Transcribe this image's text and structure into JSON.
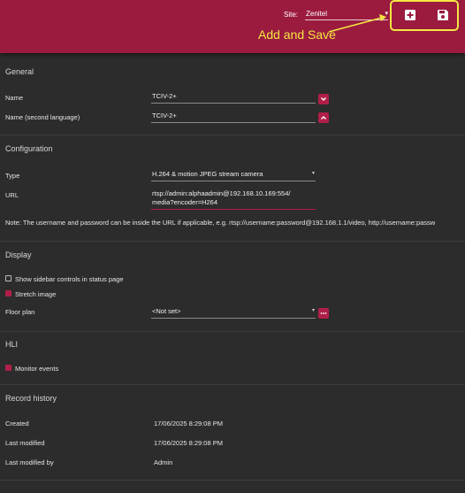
{
  "header": {
    "site_label": "Site:",
    "site_value": "Zenitel",
    "add_icon": "plus-box-icon",
    "save_icon": "floppy-disk-icon"
  },
  "annotation": {
    "text": "Add and Save",
    "color": "#f4e642"
  },
  "colors": {
    "brand": "#9b1b3f",
    "accent": "#b01f48",
    "background": "#2c2c2c"
  },
  "general": {
    "title": "General",
    "name_label": "Name",
    "name_value": "TCIV-2+",
    "name2_label": "Name (second language)",
    "name2_value": "TCIV-2+"
  },
  "configuration": {
    "title": "Configuration",
    "type_label": "Type",
    "type_value": "H.264 & motion JPEG stream camera",
    "url_label": "URL",
    "url_line1": "rtsp://admin:alphaadmin@192.168.10.169:554/",
    "url_line2": "media?encoder=H264",
    "note": "Note: The username and password can be inside the URL if applicable, e.g. rtsp://username:password@192.168.1.1/video, http://username:passw"
  },
  "display": {
    "title": "Display",
    "sidebar_label": "Show sidebar controls in status page",
    "sidebar_checked": false,
    "stretch_label": "Stretch image",
    "stretch_checked": true,
    "floorplan_label": "Floor plan",
    "floorplan_value": "<Not set>"
  },
  "hli": {
    "title": "HLI",
    "monitor_label": "Monitor events",
    "monitor_checked": true
  },
  "record_history": {
    "title": "Record history",
    "created_label": "Created",
    "created_value": "17/06/2025 8:29:08 PM",
    "modified_label": "Last modified",
    "modified_value": "17/06/2025 8:29:08 PM",
    "modified_by_label": "Last modified by",
    "modified_by_value": "Admin"
  }
}
